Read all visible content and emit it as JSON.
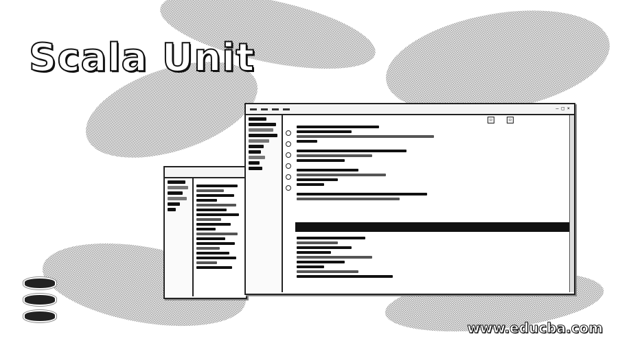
{
  "title": "Scala Unit",
  "watermark": "www.educba.com",
  "logo_icon": "scala-logo-icon",
  "front_window": {
    "toolbar_buttons": [
      "▭",
      "▭"
    ]
  },
  "colors": {
    "ink": "#111111",
    "background": "#ffffff"
  }
}
